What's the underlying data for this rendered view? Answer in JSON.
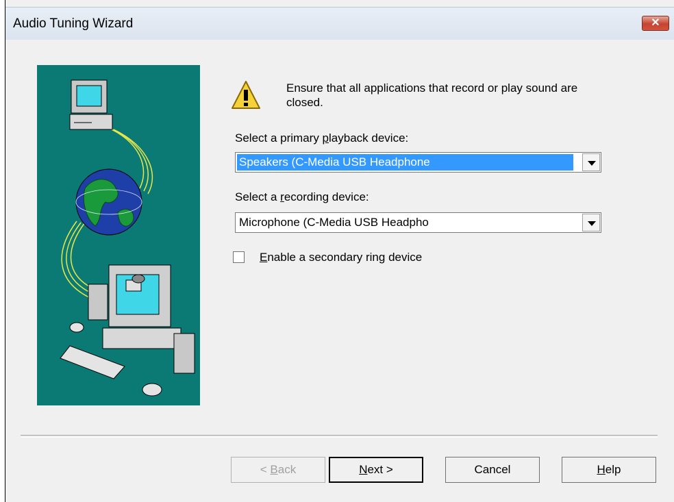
{
  "window": {
    "title": "Audio Tuning Wizard",
    "close_glyph": "✕"
  },
  "warning": {
    "icon": "warning-icon",
    "text": "Ensure that all applications that record or play sound are closed."
  },
  "playback": {
    "label_pre": "Select a primary ",
    "label_access": "p",
    "label_post": "layback device:",
    "value": "Speakers (C-Media USB Headphone"
  },
  "recording": {
    "label_pre": "Select a ",
    "label_access": "r",
    "label_post": "ecording device:",
    "value": "Microphone (C-Media USB Headpho"
  },
  "ring": {
    "access": "E",
    "label_post": "nable a secondary ring device",
    "checked": false
  },
  "buttons": {
    "back": {
      "pre": "< ",
      "access": "B",
      "post": "ack"
    },
    "next": {
      "access": "N",
      "post": "ext >"
    },
    "cancel": "Cancel",
    "help": {
      "access": "H",
      "post": "elp"
    }
  }
}
